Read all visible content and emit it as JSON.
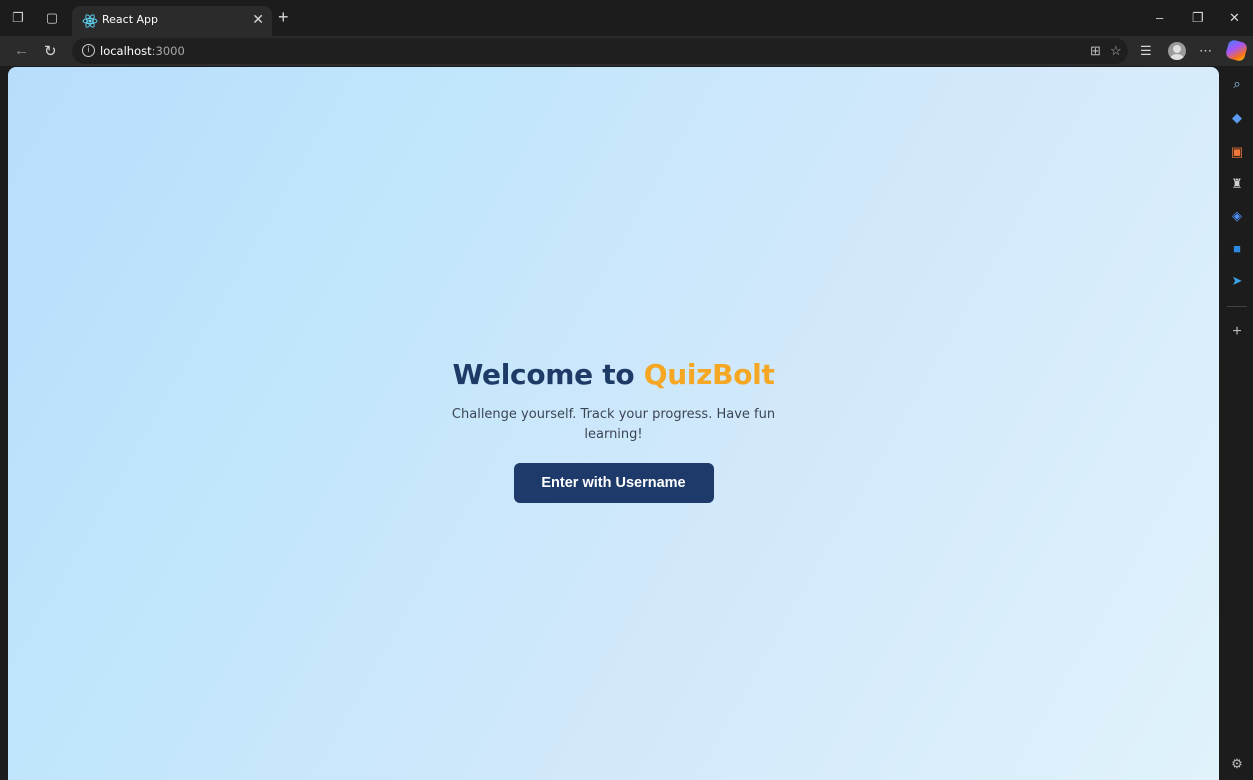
{
  "browser": {
    "tab": {
      "title": "React App",
      "favicon": "react-icon"
    },
    "address": {
      "host": "localhost",
      "port": ":3000"
    },
    "window_controls": [
      "minimize-icon",
      "restore-icon",
      "close-icon"
    ],
    "sidebar_icons": [
      "search-icon",
      "tag-icon",
      "toolbox-icon",
      "chess-icon",
      "m365-icon",
      "outlook-icon",
      "telegram-icon",
      "plus-icon",
      "settings-icon"
    ]
  },
  "page": {
    "title_prefix": "Welcome to ",
    "title_brand": "QuizBolt",
    "subtitle": "Challenge yourself. Track your progress. Have fun learning!",
    "button_label": "Enter with Username"
  },
  "colors": {
    "title": "#1e3a66",
    "brand": "#f5a623",
    "button_bg": "#1e3a6a"
  }
}
